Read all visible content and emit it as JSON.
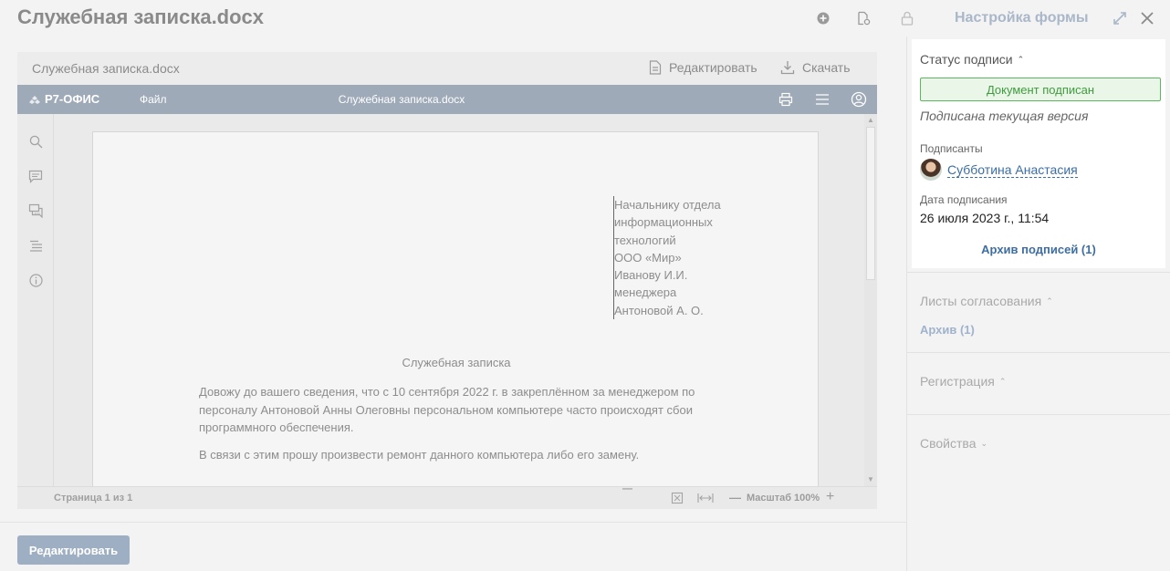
{
  "header": {
    "title": "Служебная записка.docx",
    "form_settings": "Настройка формы",
    "icons": [
      "plus-circle-icon",
      "file-settings-icon",
      "lock-icon",
      "expand-icon",
      "close-icon"
    ]
  },
  "preview": {
    "file_name": "Служебная записка.docx",
    "edit_label": "Редактировать",
    "download_label": "Скачать"
  },
  "editor": {
    "brand": "Р7-ОФИС",
    "file_menu": "Файл",
    "doc_name": "Служебная записка.docx",
    "left_tools": [
      "search-icon",
      "comment-icon",
      "chat-icon",
      "navigation-icon",
      "info-icon"
    ],
    "page_label": "Страница 1 из 1",
    "zoom_label": "Масштаб 100%",
    "zoom_minus": "—",
    "zoom_plus": "+"
  },
  "document": {
    "addressee": [
      "Начальнику отдела",
      "информационных",
      "технологий",
      "ООО «Мир»",
      "Иванову И.И.",
      "менеджера",
      "Антоновой А. О."
    ],
    "title": "Служебная записка",
    "paragraphs": [
      "Довожу до вашего сведения, что с 10 сентября 2022 г. в закреплённом за менеджером по персоналу Антоновой Анны Олеговны персональном компьютере часто происходят сбои программного обеспечения.",
      "В связи с этим прошу произвести ремонт данного компьютера либо его замену."
    ]
  },
  "footer": {
    "edit_button": "Редактировать"
  },
  "signature": {
    "heading": "Статус подписи",
    "status": "Документ подписан",
    "version_note": "Подписана текущая версия",
    "signers_label": "Подписанты",
    "signer_name": "Субботина Анастасия",
    "date_label": "Дата подписания",
    "date_value": "26 июля 2023 г., 11:54",
    "archive_link": "Архив подписей (1)",
    "status_color": "#5cb85c"
  },
  "approval": {
    "heading": "Листы согласования",
    "archive_link": "Архив (1)"
  },
  "registration": {
    "heading": "Регистрация"
  },
  "properties": {
    "heading": "Свойства"
  }
}
